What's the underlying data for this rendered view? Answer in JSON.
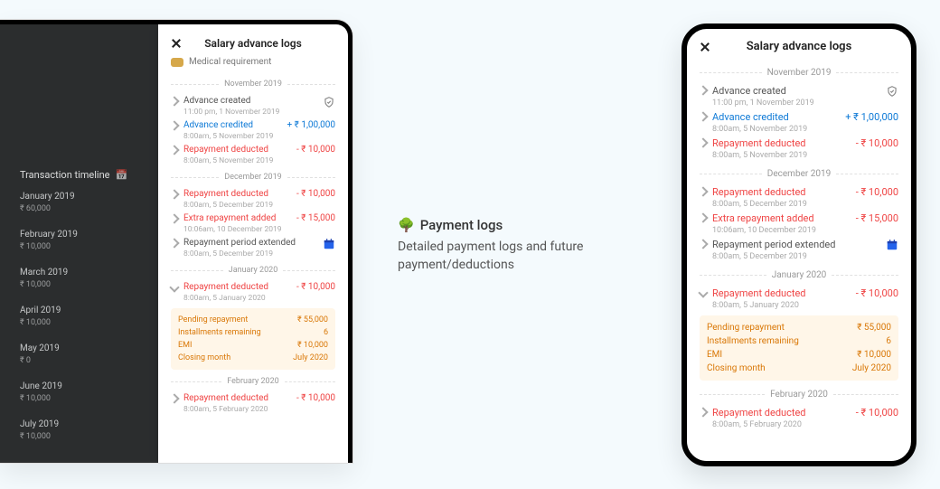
{
  "caption": {
    "emoji": "🌳",
    "heading": "Payment logs",
    "body": "Detailed payment logs and future payment/deductions"
  },
  "desktop": {
    "panel_title": "Salary advance logs",
    "subtitle": "Medical requirement",
    "dark_heading": "Transaction timeline",
    "dark_rows": [
      {
        "label": "January 2019",
        "val": "₹ 60,000"
      },
      {
        "label": "February 2019",
        "val": "₹ 10,000"
      },
      {
        "label": "March 2019",
        "val": "₹ 10,000"
      },
      {
        "label": "April 2019",
        "val": "₹ 10,000"
      },
      {
        "label": "May 2019",
        "val": "₹ 0"
      },
      {
        "label": "June 2019",
        "val": "₹ 10,000"
      },
      {
        "label": "July 2019",
        "val": "₹ 10,000"
      }
    ],
    "months": [
      {
        "label": "November 2019",
        "rows": [
          {
            "title": "Advance created",
            "time": "11:00 pm, 1 November 2019",
            "icon": "shield"
          },
          {
            "title": "Advance credited",
            "time": "8:00am, 5 November 2019",
            "amt": "+ ₹ 1,00,000",
            "color": "blue"
          },
          {
            "title": "Repayment deducted",
            "time": "8:00am, 5 November 2019",
            "amt": "- ₹ 10,000",
            "color": "red"
          }
        ]
      },
      {
        "label": "December 2019",
        "rows": [
          {
            "title": "Repayment deducted",
            "time": "8:00am, 5 December 2019",
            "amt": "- ₹ 10,000",
            "color": "red"
          },
          {
            "title": "Extra repayment added",
            "time": "10:06am, 10 December 2019",
            "amt": "- ₹ 15,000",
            "color": "red"
          },
          {
            "title": "Repayment period extended",
            "time": "8:00am, 5 December 2019",
            "icon": "calendar"
          }
        ]
      },
      {
        "label": "January 2020",
        "rows": [
          {
            "title": "Repayment deducted",
            "time": "8:00am, 5 January 2020",
            "amt": "- ₹ 10,000",
            "color": "red",
            "expanded": true
          }
        ],
        "expanded": {
          "pending_label": "Pending repayment",
          "pending_val": "₹ 55,000",
          "inst_label": "Installments remaining",
          "inst_val": "6",
          "emi_label": "EMI",
          "emi_val": "₹ 10,000",
          "close_label": "Closing month",
          "close_val": "July 2020"
        }
      },
      {
        "label": "February 2020",
        "rows": [
          {
            "title": "Repayment deducted",
            "time": "8:00am, 5 February 2020",
            "amt": "- ₹ 10,000",
            "color": "red"
          }
        ]
      }
    ]
  },
  "mobile": {
    "title": "Salary advance logs",
    "months": [
      {
        "label": "November 2019",
        "rows": [
          {
            "title": "Advance created",
            "time": "11:00 pm, 1 November 2019",
            "icon": "shield"
          },
          {
            "title": "Advance credited",
            "time": "8:00am, 5 November 2019",
            "amt": "+ ₹ 1,00,000",
            "color": "blue"
          },
          {
            "title": "Repayment deducted",
            "time": "8:00am, 5 November 2019",
            "amt": "- ₹ 10,000",
            "color": "red"
          }
        ]
      },
      {
        "label": "December 2019",
        "rows": [
          {
            "title": "Repayment deducted",
            "time": "8:00am, 5 December 2019",
            "amt": "- ₹ 10,000",
            "color": "red"
          },
          {
            "title": "Extra repayment added",
            "time": "10:06am, 10 December 2019",
            "amt": "- ₹ 15,000",
            "color": "red"
          },
          {
            "title": "Repayment period extended",
            "time": "8:00am, 5 December 2019",
            "icon": "calendar"
          }
        ]
      },
      {
        "label": "January 2020",
        "rows": [
          {
            "title": "Repayment deducted",
            "time": "8:00am, 5 January 2020",
            "amt": "- ₹ 10,000",
            "color": "red",
            "expanded": true
          }
        ],
        "expanded": {
          "pending_label": "Pending repayment",
          "pending_val": "₹ 55,000",
          "inst_label": "Installments remaining",
          "inst_val": "6",
          "emi_label": "EMI",
          "emi_val": "₹ 10,000",
          "close_label": "Closing month",
          "close_val": "July 2020"
        }
      },
      {
        "label": "February 2020",
        "rows": [
          {
            "title": "Repayment deducted",
            "time": "8:00am, 5 February 2020",
            "amt": "- ₹ 10,000",
            "color": "red"
          }
        ]
      }
    ]
  }
}
